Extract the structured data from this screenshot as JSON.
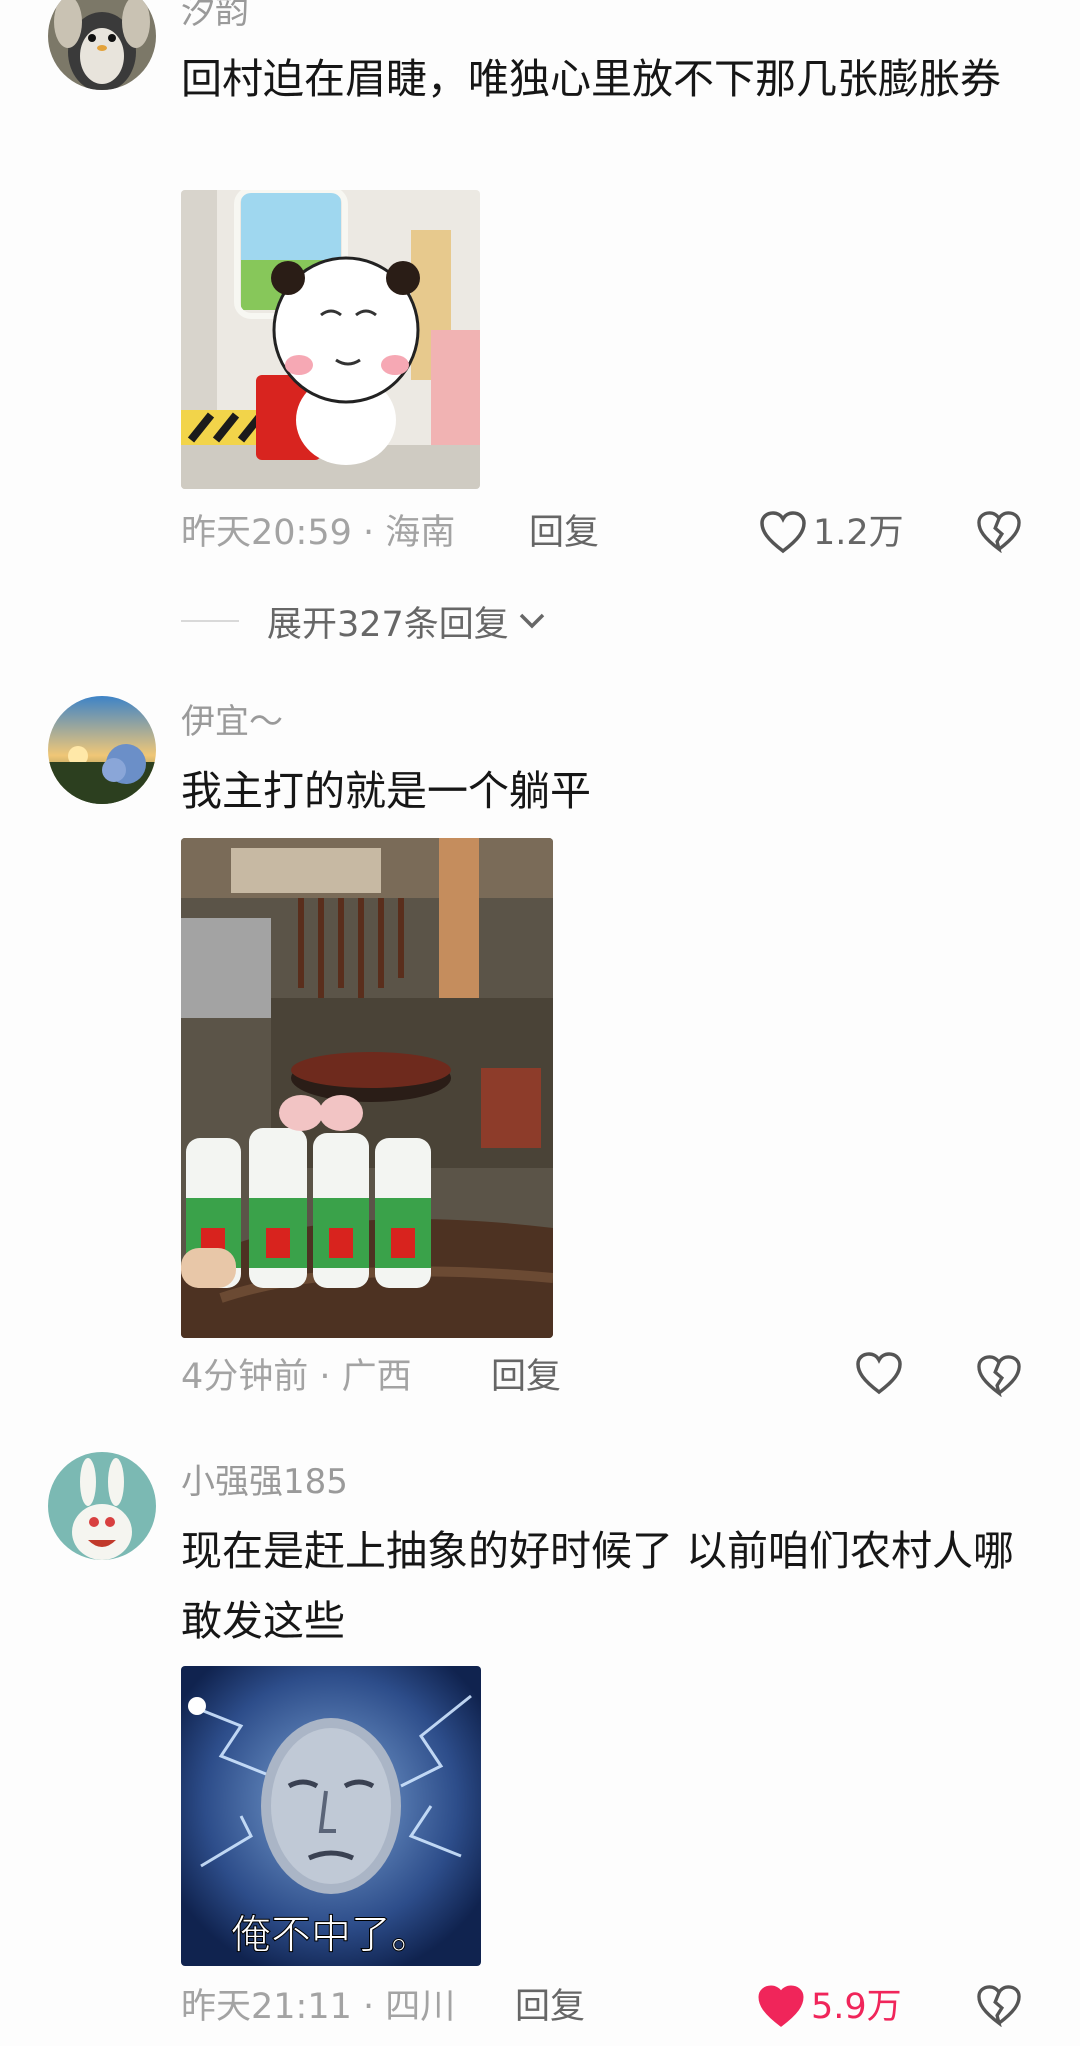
{
  "comments": [
    {
      "username": "汐韵",
      "text": "回村迫在眉睫，唯独心里放不下那几张膨胀券",
      "image_caption": "",
      "time_location": "昨天20:59 · 海南",
      "reply_label": "回复",
      "likes": "1.2万",
      "liked": false,
      "expand_label": "展开327条回复",
      "avatar": "penguin-avatar"
    },
    {
      "username": "伊宜～",
      "text": "我主打的就是一个躺平",
      "image_caption": "",
      "time_location": "4分钟前 · 广西",
      "reply_label": "回复",
      "likes": "",
      "liked": false,
      "avatar": "landscape-avatar"
    },
    {
      "username": "小强强185",
      "text": "现在是赶上抽象的好时候了 以前咱们农村人哪敢发这些",
      "image_caption": "俺不中了。",
      "time_location": "昨天21:11 · 四川",
      "reply_label": "回复",
      "likes": "5.9万",
      "liked": true,
      "avatar": "rabbid-avatar"
    }
  ],
  "colors": {
    "like_active": "#f0255a",
    "meta_text": "#a3a3a3",
    "username": "#9a9a9a"
  }
}
